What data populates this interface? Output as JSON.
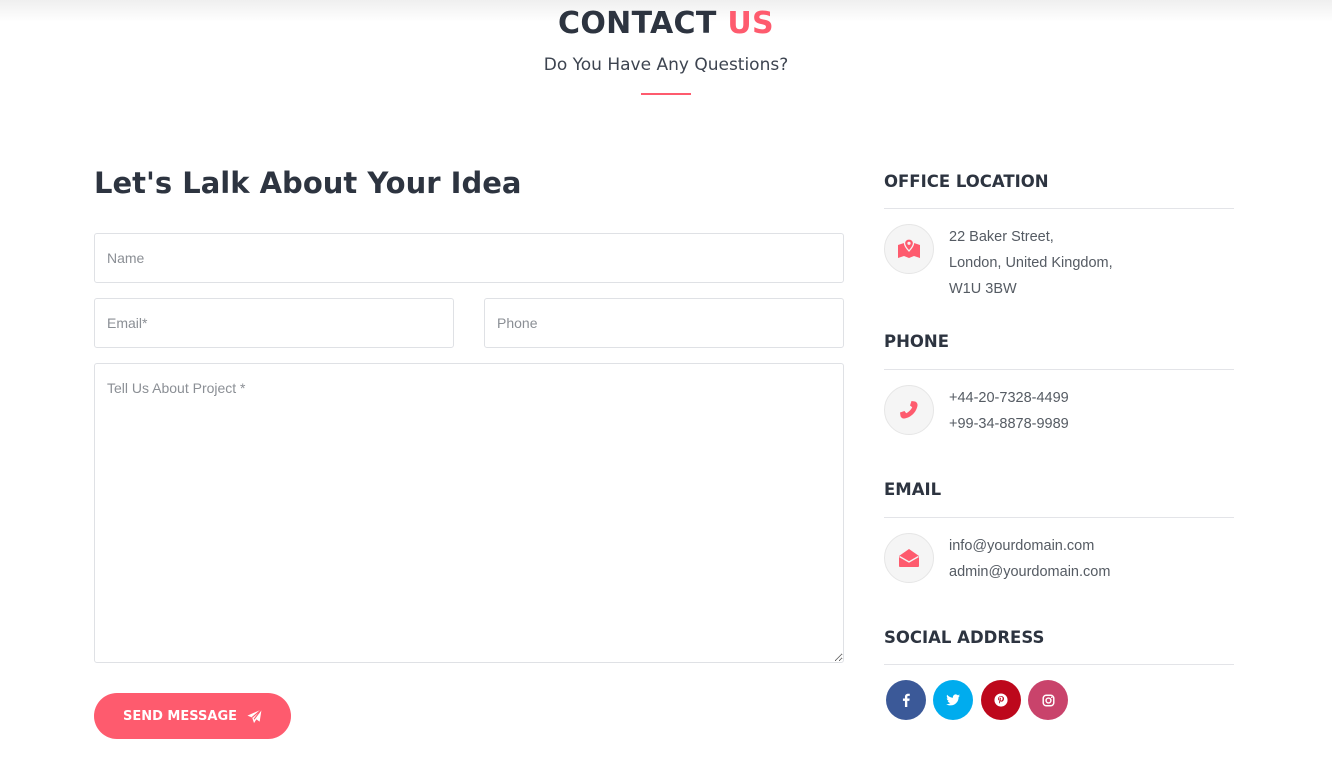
{
  "header": {
    "title_main": "CONTACT",
    "title_accent": "US",
    "subtitle": "Do You Have Any Questions?"
  },
  "form": {
    "title": "Let's Lalk About Your Idea",
    "name_placeholder": "Name",
    "email_placeholder": "Email*",
    "phone_placeholder": "Phone",
    "message_placeholder": "Tell Us About Project *",
    "send_label": "SEND MESSAGE",
    "send_icon": "paper-plane-icon"
  },
  "office": {
    "title": "OFFICE LOCATION",
    "icon": "map-marker-icon",
    "lines": [
      "22 Baker Street,",
      "London, United Kingdom,",
      "W1U 3BW"
    ]
  },
  "phone": {
    "title": "PHONE",
    "icon": "phone-icon",
    "lines": [
      "+44-20-7328-4499",
      "+99-34-8878-9989"
    ]
  },
  "email": {
    "title": "EMAIL",
    "icon": "envelope-icon",
    "lines": [
      "info@yourdomain.com",
      "admin@yourdomain.com"
    ]
  },
  "social": {
    "title": "SOCIAL ADDRESS",
    "links": [
      {
        "icon": "facebook-icon",
        "color": "#3b5998"
      },
      {
        "icon": "twitter-icon",
        "color": "#00acee"
      },
      {
        "icon": "pinterest-icon",
        "color": "#bd081c"
      },
      {
        "icon": "instagram-icon",
        "color": "#c9436b"
      }
    ]
  },
  "colors": {
    "accent": "#fe5b6e",
    "heading": "#2d3440",
    "text": "#555b63"
  }
}
